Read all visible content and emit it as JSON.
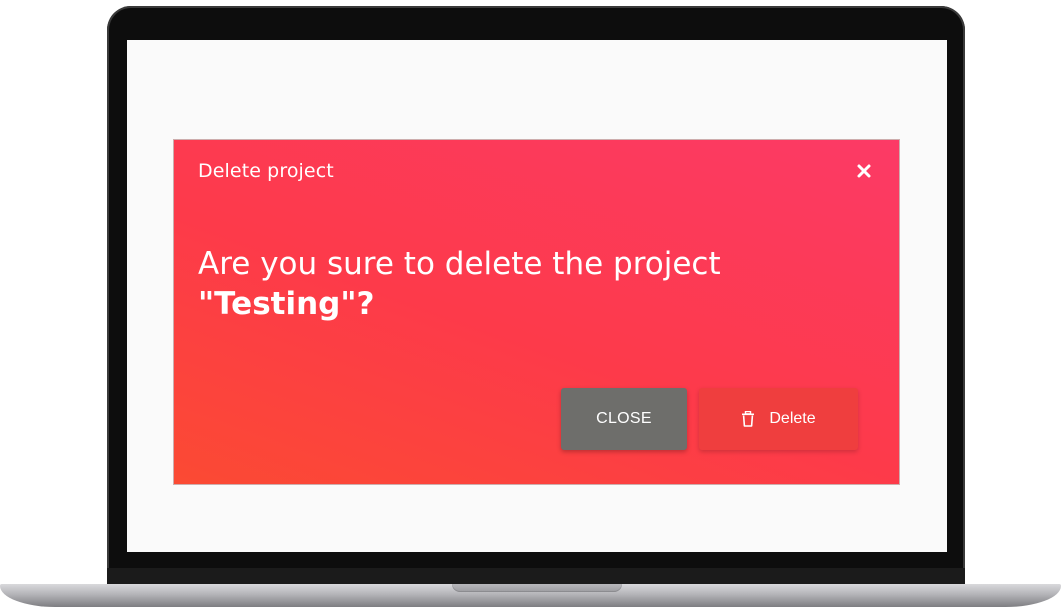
{
  "modal": {
    "title": "Delete project",
    "message_prefix": "Are you sure to delete the project",
    "project_name": "\"Testing\"?",
    "close_button_label": "CLOSE",
    "delete_button_label": "Delete",
    "close_icon": "close-icon",
    "delete_icon": "trash-icon"
  },
  "colors": {
    "modal_gradient_start": "#fb4a33",
    "modal_gradient_end": "#fc3a66",
    "close_button_bg": "#6e6e6b",
    "delete_button_bg": "#ef3e3e"
  }
}
